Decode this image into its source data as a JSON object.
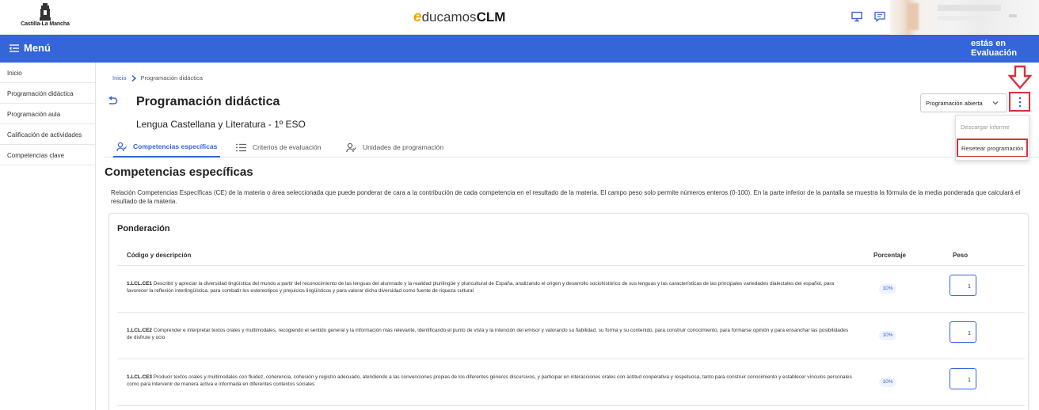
{
  "header": {
    "logo_text": "Castilla-La Mancha",
    "brand_e": "e",
    "brand_mid": "ducamos",
    "brand_end": "CLM"
  },
  "bluebar": {
    "menu_label": "Menú",
    "context_line1": "estás en",
    "context_line2": "Evaluación"
  },
  "sidebar": {
    "items": [
      {
        "label": "Inicio"
      },
      {
        "label": "Programación didáctica"
      },
      {
        "label": "Programación aula"
      },
      {
        "label": "Calificación de actividades"
      },
      {
        "label": "Competencias clave"
      }
    ]
  },
  "breadcrumb": {
    "home": "Inicio",
    "current": "Programación didáctica"
  },
  "page": {
    "title": "Programación didáctica",
    "subject": "Lengua Castellana y Literatura - 1º ESO",
    "select_value": "Programación abierta"
  },
  "menu_dropdown": {
    "items": [
      {
        "label": "Descargar informe"
      },
      {
        "label": "Resetear programación"
      }
    ]
  },
  "tabs": [
    {
      "label": "Competencias específicas"
    },
    {
      "label": "Criterios de evaluación"
    },
    {
      "label": "Unidades de programación"
    }
  ],
  "section": {
    "title": "Competencias específicas",
    "description": "Relación Competencias Específicas (CE) de la materia o área seleccionada que puede ponderar de cara a la contribución de cada competencia en el resultado de la materia. El campo peso solo permite números enteros (0-100). En la parte inferior de la pantalla se muestra la fórmula de la media ponderada que calculará el resultado de la materia."
  },
  "ponderacion": {
    "title": "Ponderación",
    "columns": [
      "Código y descripción",
      "Porcentaje",
      "Peso"
    ],
    "rows": [
      {
        "code": "1.LCL.CE1",
        "text": " Describir y apreciar la diversidad lingüística del mundo a partir del reconocimiento de las lenguas del alumnado y la realidad plurilingüe y pluricultural de España, analizando el origen y desarrollo sociohistórico de sus lenguas y las características de las principales variedades dialectales del español, para favorecer la reflexión interlingüística, para combatir los estereotipos y prejuicios lingüísticos y para valorar dicha diversidad como fuente de riqueza cultural",
        "percentage": "10%",
        "weight": "1"
      },
      {
        "code": "1.LCL.CE2",
        "text": " Comprender e interpretar textos orales y multimodales, recogiendo el sentido general y la información más relevante, identificando el punto de vista y la intención del emisor y valorando su fiabilidad, su forma y su contenido, para construir conocimiento, para formarse opinión y para ensanchar las posibilidades de disfrute y ocio",
        "percentage": "10%",
        "weight": "1"
      },
      {
        "code": "1.LCL.CE3",
        "text": " Producir textos orales y multimodales con fluidez, coherencia, cohesión y registro adecuado, atendiendo a las convenciones propias de los diferentes géneros discursivos, y participar en interacciones orales con actitud cooperativa y respetuosa, tanto para construir conocimiento y establecer vínculos personales como para intervenir de manera activa e informada en diferentes contextos sociales",
        "percentage": "10%",
        "weight": "1"
      }
    ]
  },
  "colors": {
    "primary": "#3465d9",
    "highlight_red": "#d9303a",
    "brand_orange": "#f0a500"
  },
  "icons": [
    "jccm-logo-icon",
    "monitor-icon",
    "chat-icon",
    "menu-icon",
    "back-arrow-icon",
    "chevron-right-icon",
    "chevron-down-icon",
    "kebab-icon",
    "red-down-arrow-icon",
    "users-icon",
    "list-icon"
  ]
}
